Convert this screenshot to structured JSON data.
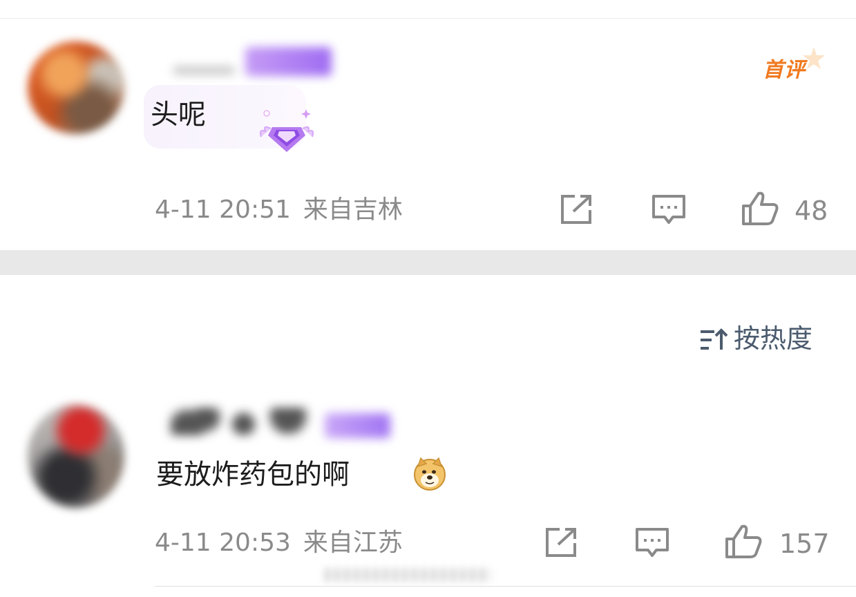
{
  "comments": [
    {
      "text": "头呢",
      "time": "4-11 20:51",
      "location": "来自吉林",
      "likes": "48",
      "badge": "首评"
    },
    {
      "text": "要放炸药包的啊",
      "time": "4-11 20:53",
      "location": "来自江苏",
      "likes": "157"
    }
  ],
  "sort": {
    "label": "按热度"
  },
  "icons": {
    "share": "share-icon",
    "comment": "comment-icon",
    "like": "thumbs-up-icon",
    "sort": "sort-icon",
    "doge": "doge-emoji-icon",
    "gem": "diamond-badge-icon"
  },
  "colors": {
    "text": "#1c1c1c",
    "meta": "#8a8a8a",
    "badge": "#f07a1f",
    "sort": "#4b5b6e",
    "band": "#e8e8e8"
  }
}
